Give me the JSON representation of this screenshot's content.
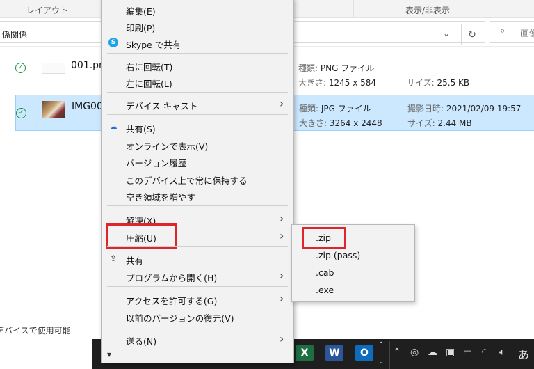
{
  "ribbon": {
    "layout_label": "レイアウト",
    "view_label": "表示/非表示"
  },
  "address": {
    "path_text": "係関係",
    "search_placeholder": "画像"
  },
  "files": [
    {
      "name": "001.pn",
      "type_label": "種類:",
      "type_value": "PNG ファイル",
      "size_label": "大きさ:",
      "size_value": "1245 x 584",
      "extra_label": "",
      "extra_value": "",
      "filesize_label": "サイズ:",
      "filesize_value": "25.5 KB",
      "selected": false
    },
    {
      "name": "IMG00",
      "type_label": "種類:",
      "type_value": "JPG ファイル",
      "size_label": "大きさ:",
      "size_value": "3264 x 2448",
      "extra_label": "撮影日時:",
      "extra_value": "2021/02/09 19:57",
      "filesize_label": "サイズ:",
      "filesize_value": "2.44 MB",
      "selected": true
    }
  ],
  "footer": {
    "text": "デバイスで使用可能"
  },
  "context_menu": {
    "items": [
      {
        "label": "編集(E)"
      },
      {
        "label": "印刷(P)"
      },
      {
        "label": "Skype で共有",
        "icon": "skype-icon"
      },
      {
        "label": "右に回転(T)"
      },
      {
        "label": "左に回転(L)"
      },
      {
        "label": "デバイス キャスト",
        "submenu": true
      },
      {
        "label": "共有(S)",
        "icon": "onedrive-cloud-icon"
      },
      {
        "label": "オンラインで表示(V)"
      },
      {
        "label": "バージョン履歴"
      },
      {
        "label": "このデバイス上で常に保持する"
      },
      {
        "label": "空き領域を増やす"
      },
      {
        "label": "解凍(X)",
        "submenu": true
      },
      {
        "label": "圧縮(U)",
        "submenu": true,
        "highlighted": true
      },
      {
        "label": "共有",
        "icon": "share-icon"
      },
      {
        "label": "プログラムから開く(H)",
        "submenu": true
      },
      {
        "label": "アクセスを許可する(G)",
        "submenu": true
      },
      {
        "label": "以前のバージョンの復元(V)"
      },
      {
        "label": "送る(N)",
        "submenu": true
      }
    ]
  },
  "compress_submenu": {
    "items": [
      {
        "label": ".zip",
        "highlighted": true
      },
      {
        "label": ".zip (pass)"
      },
      {
        "label": ".cab"
      },
      {
        "label": ".exe"
      }
    ]
  },
  "taskbar": {
    "apps": [
      {
        "name": "excel",
        "glyph": "X",
        "color": "#1d6f42"
      },
      {
        "name": "word",
        "glyph": "W",
        "color": "#2b579a"
      },
      {
        "name": "outlook",
        "glyph": "O",
        "color": "#0f6cbd"
      }
    ],
    "ime_label": "あ"
  },
  "colors": {
    "highlight": "#e0242b",
    "selection": "#cce8ff",
    "menu_bg": "#f2f2f2"
  }
}
